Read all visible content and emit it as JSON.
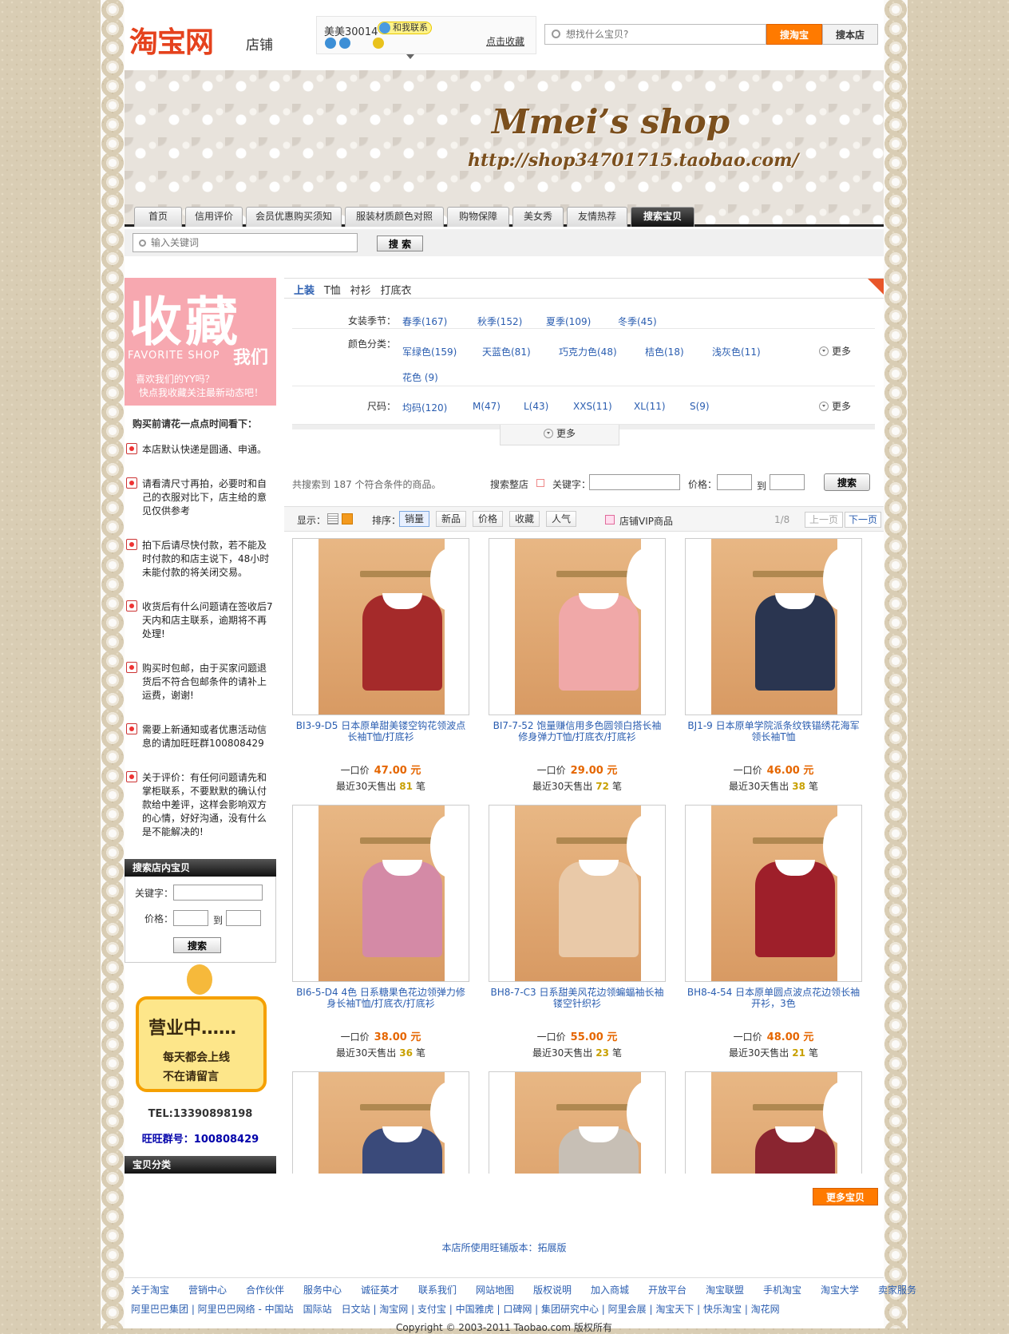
{
  "header": {
    "logo": "淘宝网",
    "logo_sub": "店铺",
    "seller_nick": "美美30014",
    "contact_label": "和我联系",
    "fav_link": "点击收藏",
    "search_placeholder": "想找什么宝贝?",
    "btn_taobao": "搜淘宝",
    "btn_shop": "搜本店"
  },
  "banner": {
    "shop_name": "Mmei’s shop",
    "shop_url": "http://shop34701715.taobao.com/"
  },
  "nav": {
    "tabs": [
      "首页",
      "信用评价",
      "会员优惠购买须知",
      "服装材质颜色对照",
      "购物保障",
      "美女秀",
      "友情热荐",
      "搜索宝贝"
    ]
  },
  "quick_search": {
    "placeholder": "输入关键词",
    "button": "搜 索"
  },
  "sidebar": {
    "fav_big": "收藏",
    "fav_en": "FAVORITE SHOP",
    "fav_we": "我们",
    "fav_t1": "喜欢我们的YY吗？",
    "fav_t2": "快点我收藏关注最新动态吧！",
    "notes_title": "购买前请花一点点时间看下：",
    "notes": [
      "本店默认快递是圆通、申通。",
      "请看清尺寸再拍，必要时和自己的衣服对比下，店主给的意见仅供参考",
      "拍下后请尽快付款，若不能及时付款的和店主说下，48小时未能付款的将关闭交易。",
      "收货后有什么问题请在签收后7天内和店主联系，逾期将不再处理!",
      "购买时包邮，由于买家问题退货后不符合包邮条件的请补上运费，谢谢!",
      "需要上新通知或者优惠活动信息的请加旺旺群100808429",
      "关于评价：有任何问题请先和掌柜联系，不要默默的确认付款给中差评，这样会影响双方的心情，好好沟通，没有什么是不能解决的!"
    ],
    "search_title": "搜索店内宝贝",
    "kw_label": "关键字：",
    "price_label": "价格：",
    "to": "到",
    "search_btn": "搜索",
    "open_big": "营业中……",
    "open_l2": "每天都会上线",
    "open_l3": "不在请留言",
    "tel": "TEL:13390898198",
    "ww_group": "旺旺群号：100808429",
    "cat_title": "宝贝分类"
  },
  "main": {
    "crumbs": [
      "上装",
      "T恤",
      "衬衫",
      "打底衣"
    ],
    "filters": [
      {
        "label": "女装季节：",
        "values": [
          "春季(167)",
          "秋季(152)",
          "夏季(109)",
          "冬季(45)"
        ]
      },
      {
        "label": "颜色分类：",
        "values": [
          "军绿色(159)",
          "天蓝色(81)",
          "巧克力色(48)",
          "桔色(18)",
          "浅灰色(11)",
          "花色 (9)"
        ]
      },
      {
        "label": "尺码：",
        "values": [
          "均码(120)",
          "M(47)",
          "L(43)",
          "XXS(11)",
          "XL(11)",
          "S(9)"
        ]
      }
    ],
    "more": "更多",
    "result_text": "共搜索到 187 个符合条件的商品。",
    "result_shop": "搜索整店",
    "kw": "关键字：",
    "price": "价格：",
    "to": "到",
    "search": "搜索",
    "sort": {
      "display": "显示：",
      "sort": "排序：",
      "items": [
        "销量",
        "新品",
        "价格",
        "收藏",
        "人气"
      ],
      "vip": "店铺VIP商品",
      "page": "1/8",
      "prev": "上一页",
      "next": "下一页"
    },
    "products": [
      {
        "title": "BI3-9-D5 日本原单甜美镂空钩花领波点长袖T恤/打底衫",
        "label": "一口价",
        "price": "47.00 元",
        "sold_pre": "最近30天售出",
        "sold": "81",
        "sold_post": "笔",
        "color": "#a52a2a"
      },
      {
        "title": "BI7-7-52 饱量赚信用多色圆领白搭长袖修身弹力T恤/打底衣/打底衫",
        "label": "一口价",
        "price": "29.00 元",
        "sold_pre": "最近30天售出",
        "sold": "72",
        "sold_post": "笔",
        "color": "#f0a8a8"
      },
      {
        "title": "BJ1-9 日本原单学院派条纹铁锚绣花海军领长袖T恤",
        "label": "一口价",
        "price": "46.00 元",
        "sold_pre": "最近30天售出",
        "sold": "38",
        "sold_post": "笔",
        "color": "#2a3550"
      },
      {
        "title": "BI6-5-D4 4色 日系糖果色花边领弹力修身长袖T恤/打底衣/打底衫",
        "label": "一口价",
        "price": "38.00 元",
        "sold_pre": "最近30天售出",
        "sold": "36",
        "sold_post": "笔",
        "color": "#d48aa6"
      },
      {
        "title": "BH8-7-C3 日系甜美风花边领蝙蝠袖长袖镂空针织衫",
        "label": "一口价",
        "price": "55.00 元",
        "sold_pre": "最近30天售出",
        "sold": "23",
        "sold_post": "笔",
        "color": "#e9c9a8"
      },
      {
        "title": "BH8-4-54 日本原单圆点波点花边领长袖开衫，3色",
        "label": "一口价",
        "price": "48.00 元",
        "sold_pre": "最近30天售出",
        "sold": "21",
        "sold_post": "笔",
        "color": "#9e1f2a"
      },
      {
        "title": "",
        "label": "",
        "price": "",
        "sold_pre": "",
        "sold": "",
        "sold_post": "",
        "color": "#3a4a7a"
      },
      {
        "title": "",
        "label": "",
        "price": "",
        "sold_pre": "",
        "sold": "",
        "sold_post": "",
        "color": "#c7bfb5"
      },
      {
        "title": "",
        "label": "",
        "price": "",
        "sold_pre": "",
        "sold": "",
        "sold_post": "",
        "color": "#8a2530"
      }
    ],
    "more_items": "更多宝贝"
  },
  "footer": {
    "ww_version": "本店所使用旺铺版本：拓展版",
    "row1": "关于淘宝　　营销中心　　合作伙伴　　服务中心　　诚征英才　　联系我们　　网站地图　　版权说明　　加入商城　　开放平台　　淘宝联盟　　手机淘宝　　淘宝大学　　卖家服务",
    "row2": "阿里巴巴集团 | 阿里巴巴网络 - 中国站　国际站　日文站 | 淘宝网 | 支付宝 | 中国雅虎 | 口碑网 | 集团研究中心 | 阿里会展 | 淘宝天下 | 快乐淘宝 | 淘花网",
    "copyright": "Copyright © 2003-2011 Taobao.com 版权所有"
  }
}
